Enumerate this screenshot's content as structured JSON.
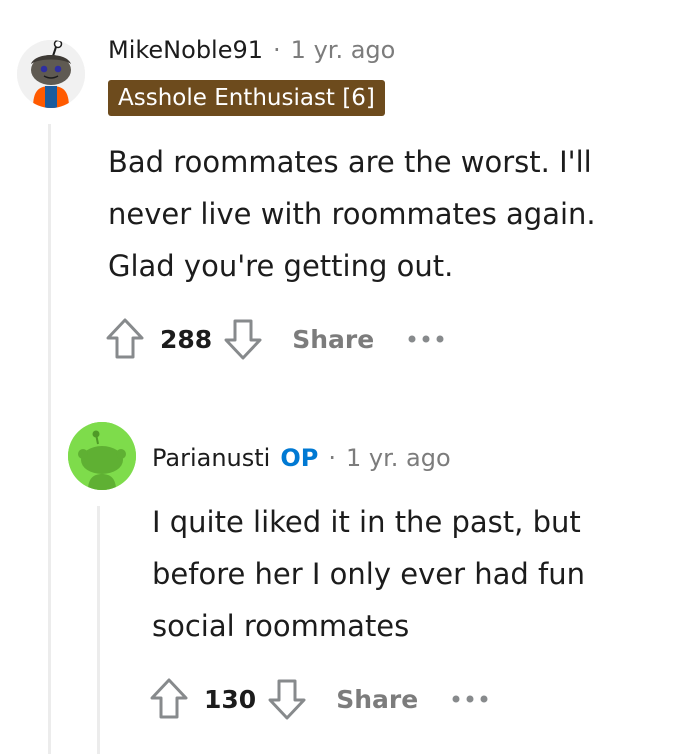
{
  "comment": {
    "username": "MikeNoble91",
    "separator": "·",
    "time": "1 yr. ago",
    "flair": "Asshole Enthusiast [6]",
    "body_lines": [
      "Bad roommates are the worst. I'll",
      "never live with roommates again.",
      "Glad you're getting out."
    ],
    "score": "288",
    "share_label": "Share",
    "avatar_icon": "snoo-avatar-icon"
  },
  "reply": {
    "username": "Parianusti",
    "op_label": "OP",
    "separator": "·",
    "time": "1 yr. ago",
    "body_lines": [
      "I quite liked it in the past, but",
      "before her I only ever had fun",
      "social roommates"
    ],
    "score": "130",
    "share_label": "Share",
    "avatar_icon": "snoo-avatar-icon"
  },
  "colors": {
    "flair_bg": "#6d4b1d",
    "op_blue": "#0079d3",
    "muted_gray": "#7c7c7c",
    "avatar2_bg": "#7edc4b"
  }
}
